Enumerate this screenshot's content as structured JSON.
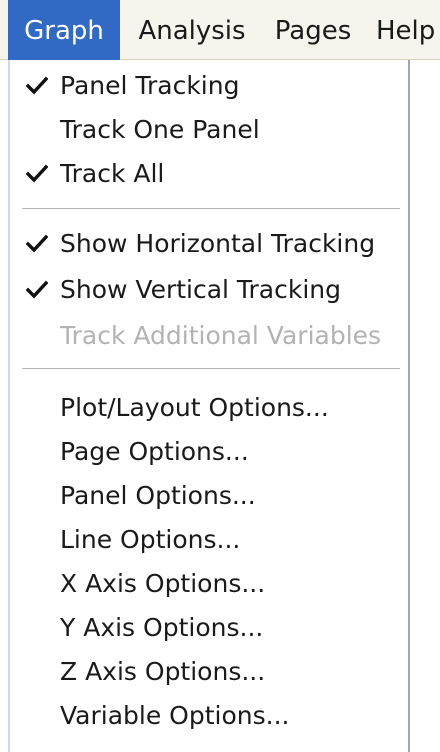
{
  "menubar": {
    "items": [
      {
        "label": "Graph"
      },
      {
        "label": "Analysis"
      },
      {
        "label": "Pages"
      },
      {
        "label": "Help"
      }
    ]
  },
  "dropdown": {
    "group1": [
      {
        "label": "Panel Tracking",
        "checked": true
      },
      {
        "label": "Track One Panel",
        "checked": false
      },
      {
        "label": "Track All",
        "checked": true
      }
    ],
    "group2": [
      {
        "label": "Show Horizontal Tracking",
        "checked": true
      },
      {
        "label": "Show Vertical Tracking",
        "checked": true
      },
      {
        "label": "Track Additional Variables",
        "checked": false,
        "disabled": true
      }
    ],
    "group3": [
      {
        "label": "Plot/Layout Options..."
      },
      {
        "label": "Page Options..."
      },
      {
        "label": "Panel Options..."
      },
      {
        "label": "Line Options..."
      },
      {
        "label": "X Axis Options..."
      },
      {
        "label": "Y Axis Options..."
      },
      {
        "label": "Z Axis Options..."
      },
      {
        "label": "Variable Options..."
      }
    ]
  },
  "colors": {
    "menubar_active_bg": "#316ac5",
    "disabled_text": "#b3b3b3"
  }
}
